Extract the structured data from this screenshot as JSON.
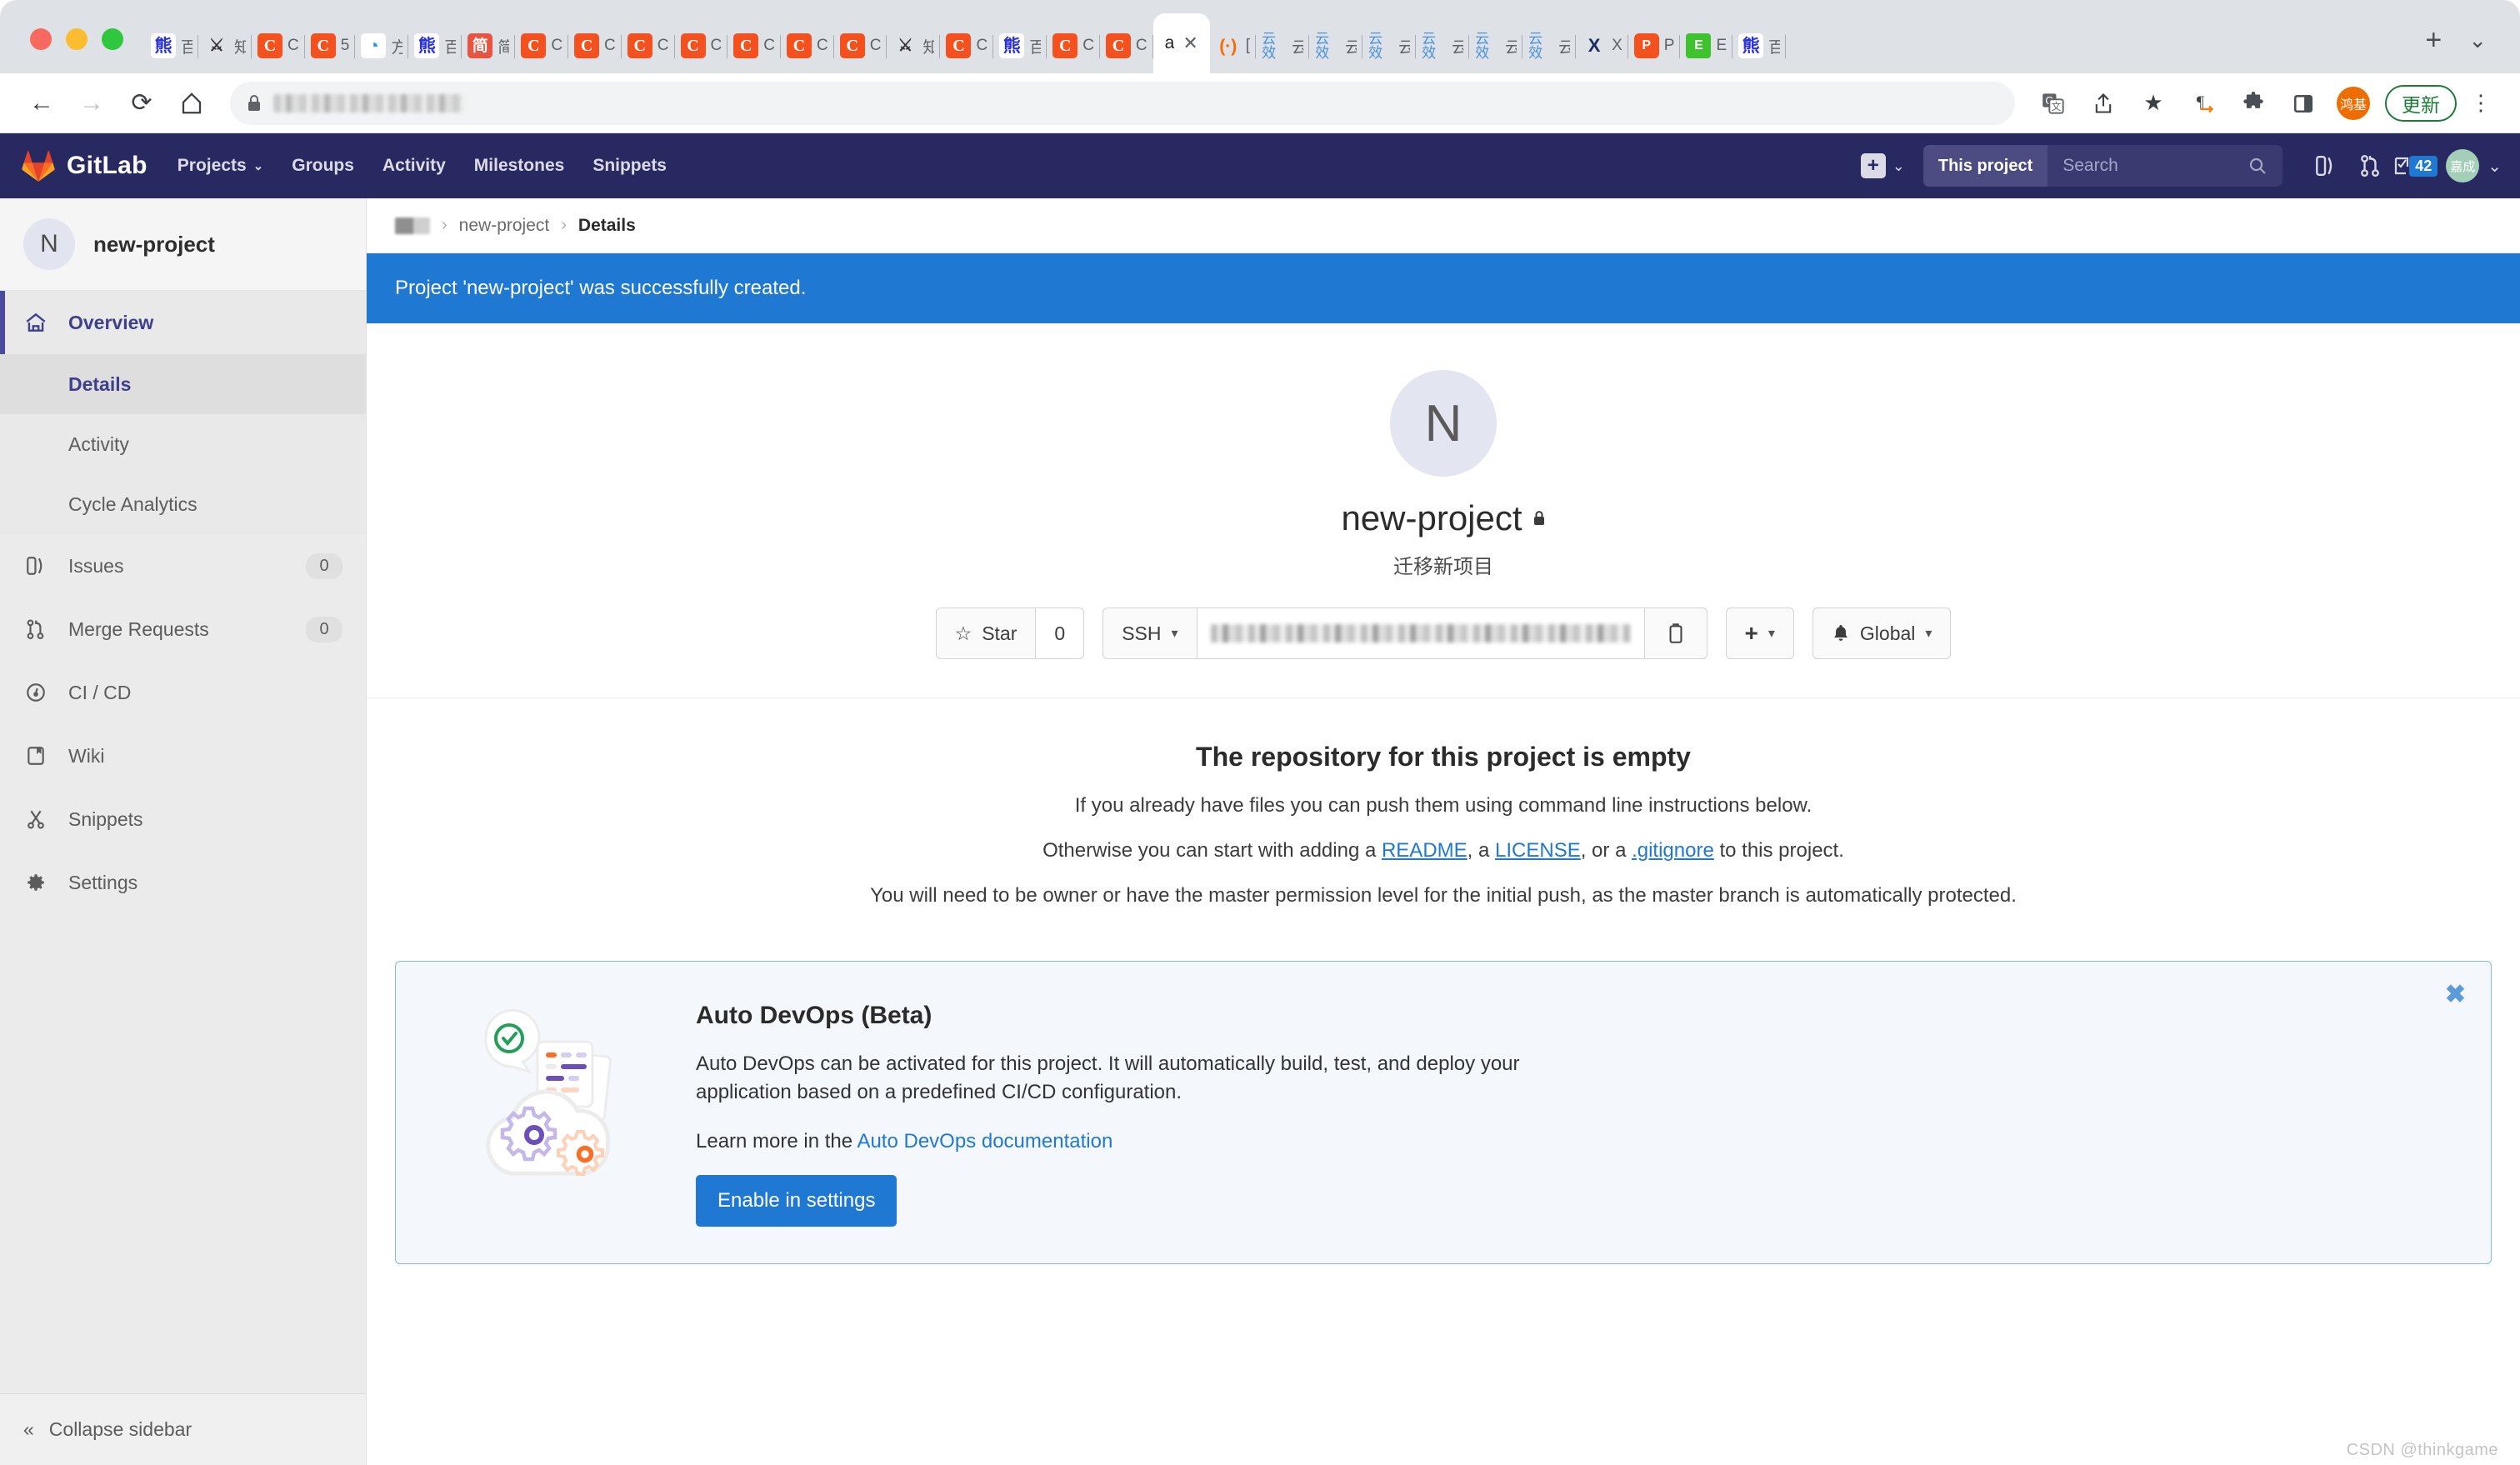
{
  "browser": {
    "tabs": [
      {
        "icon": "baidu-favicon",
        "title": "百"
      },
      {
        "icon": "person-favicon",
        "title": "知"
      },
      {
        "icon": "csdn-favicon",
        "title": "C"
      },
      {
        "icon": "csdn-favicon",
        "title": "5"
      },
      {
        "icon": "blue-favicon",
        "title": "方"
      },
      {
        "icon": "baidu-favicon",
        "title": "百"
      },
      {
        "icon": "jianshu-favicon",
        "title": "简"
      },
      {
        "icon": "csdn-favicon",
        "title": "C"
      },
      {
        "icon": "csdn-favicon",
        "title": "C"
      },
      {
        "icon": "csdn-favicon",
        "title": "C"
      },
      {
        "icon": "csdn-favicon",
        "title": "C"
      },
      {
        "icon": "csdn-favicon",
        "title": "C"
      },
      {
        "icon": "csdn-favicon",
        "title": "C"
      },
      {
        "icon": "csdn-favicon",
        "title": "C"
      },
      {
        "icon": "person-favicon",
        "title": "知"
      },
      {
        "icon": "csdn-favicon",
        "title": "C"
      },
      {
        "icon": "baidu-favicon",
        "title": "百"
      },
      {
        "icon": "csdn-favicon",
        "title": "C"
      },
      {
        "icon": "csdn-favicon",
        "title": "C"
      }
    ],
    "active_tab": {
      "title": "a",
      "close_label": "✕"
    },
    "tabs_right": [
      {
        "icon": "gitlab-paren-favicon",
        "title": "["
      },
      {
        "icon": "yunxiao-favicon",
        "title": "云效"
      },
      {
        "icon": "yunxiao-favicon",
        "title": "云效"
      },
      {
        "icon": "yunxiao-favicon",
        "title": "云效"
      },
      {
        "icon": "yunxiao-favicon",
        "title": "云效"
      },
      {
        "icon": "yunxiao-favicon",
        "title": "云效"
      },
      {
        "icon": "yunxiao-favicon",
        "title": "云效"
      },
      {
        "icon": "xmind-favicon",
        "title": "X"
      },
      {
        "icon": "powerpoint-favicon",
        "title": "P"
      },
      {
        "icon": "excel-favicon",
        "title": "E"
      },
      {
        "icon": "baidu-favicon",
        "title": "百"
      }
    ],
    "new_tab_label": "+",
    "tab_list_label": "⌄",
    "toolbar": {
      "back": "←",
      "forward": "→",
      "reload": "⟳",
      "home": "⌂",
      "lock": "🔒",
      "url_value": "",
      "translate": "translate-icon",
      "share": "share-icon",
      "bookmark": "★",
      "reader": "¶",
      "extensions": "extensions-icon",
      "sidepanel": "sidepanel-icon",
      "profile_initials": "鸿基",
      "update_label": "更新",
      "menu": "⋮"
    }
  },
  "gitlab_nav": {
    "brand": "GitLab",
    "menu": [
      {
        "label": "Projects",
        "has_caret": true
      },
      {
        "label": "Groups",
        "has_caret": false
      },
      {
        "label": "Activity",
        "has_caret": false
      },
      {
        "label": "Milestones",
        "has_caret": false
      },
      {
        "label": "Snippets",
        "has_caret": false
      }
    ],
    "plus_caret": "⌄",
    "search_scope": "This project",
    "search_placeholder": "Search",
    "search_value": "",
    "issues_icon": "issues-icon",
    "merge_icon": "merge-requests-icon",
    "todos_icon": "todos-icon",
    "todos_count": "42",
    "avatar_initials": "嘉成",
    "avatar_caret": "⌄"
  },
  "sidebar": {
    "project_initial": "N",
    "project_name": "new-project",
    "items": [
      {
        "label": "Overview",
        "icon": "home-icon",
        "active": true,
        "count": null
      },
      {
        "label": "Details",
        "sub": true,
        "current": true
      },
      {
        "label": "Activity",
        "sub": true,
        "current": false
      },
      {
        "label": "Cycle Analytics",
        "sub": true,
        "current": false
      },
      {
        "label": "Issues",
        "icon": "issues-icon",
        "count": "0"
      },
      {
        "label": "Merge Requests",
        "icon": "merge-requests-icon",
        "count": "0"
      },
      {
        "label": "CI / CD",
        "icon": "cicd-icon",
        "count": null
      },
      {
        "label": "Wiki",
        "icon": "wiki-icon",
        "count": null
      },
      {
        "label": "Snippets",
        "icon": "snippets-icon",
        "count": null
      },
      {
        "label": "Settings",
        "icon": "gear-icon",
        "count": null
      }
    ],
    "collapse_label": "Collapse sidebar",
    "collapse_icon": "«"
  },
  "breadcrumb": {
    "project": "new-project",
    "current": "Details",
    "separator": "›"
  },
  "alert": {
    "message": "Project 'new-project' was successfully created."
  },
  "project": {
    "initial": "N",
    "name": "new-project",
    "visibility_icon": "lock-icon",
    "description": "迁移新项目",
    "star_label": "Star",
    "star_icon": "☆",
    "star_count": "0",
    "protocol_label": "SSH",
    "clone_url": "",
    "copy_icon": "copy-icon",
    "add_label": "+",
    "notification_label": "Global",
    "notification_icon": "bell-icon",
    "caret": "▾"
  },
  "empty_repo": {
    "title": "The repository for this project is empty",
    "line1": "If you already have files you can push them using command line instructions below.",
    "line2_pre": "Otherwise you can start with adding a ",
    "link_readme": "README",
    "line2_mid1": ", a ",
    "link_license": "LICENSE",
    "line2_mid2": ", or a ",
    "link_gitignore": ".gitignore",
    "line2_post": " to this project.",
    "line3": "You will need to be owner or have the master permission level for the initial push, as the master branch is automatically protected."
  },
  "auto_devops": {
    "title": "Auto DevOps (Beta)",
    "paragraph": "Auto DevOps can be activated for this project. It will automatically build, test, and deploy your application based on a predefined CI/CD configuration.",
    "learn_pre": "Learn more in the ",
    "learn_link": "Auto DevOps documentation",
    "button_label": "Enable in settings",
    "close_icon": "✖",
    "illustration": "cloud-gears-illustration"
  },
  "watermark": "CSDN @thinkgame",
  "colors": {
    "gitlab_navy": "#292961",
    "accent_blue": "#1f78d1",
    "sidebar_bg": "#ebebeb",
    "orange": "#fc6d26"
  }
}
